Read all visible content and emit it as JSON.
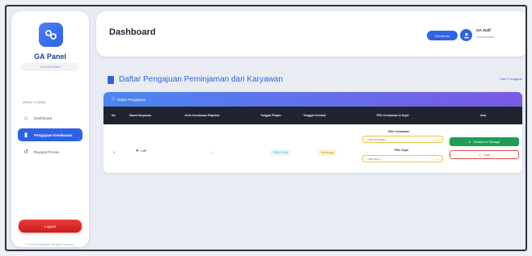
{
  "sidebar": {
    "brand": "GA Panel",
    "brand_sub": "General Affairs",
    "nav_heading": "MENU UTAMA",
    "items": [
      {
        "label": "Dashboard",
        "icon": "home-icon"
      },
      {
        "label": "Pengajuan Kendaraan",
        "icon": "document-icon"
      },
      {
        "label": "Riwayat Proses",
        "icon": "history-icon"
      }
    ],
    "logout_label": "Logout",
    "copyright": "© 2024 GA System. All rights reserved."
  },
  "header": {
    "title": "Dashboard",
    "role_badge": "GA Admin",
    "user_name": "GA Staff",
    "user_role": "General Affairs"
  },
  "section": {
    "title": "Daftar Pengajuan Peminjaman dari Karyawan",
    "link": "Total 1 Pengajuan"
  },
  "table": {
    "card_title": "Daftar Pengajuan",
    "columns": [
      "No",
      "Nama Karyawan",
      "Jenis Kendaraan Diajukan",
      "Tanggal Pinjam",
      "Tanggal Kembali",
      "Pilih Kendaraan & Sopir",
      "Aksi"
    ],
    "rows": [
      {
        "no": "1",
        "name": "luffi",
        "vehicle": "—",
        "date_borrow": "2024-12-06",
        "date_return": "Menunggu",
        "label_vehicle": "Pilih Kendaraan",
        "select_vehicle": "-- Pilih Kendaraan --",
        "label_driver": "Pilih Sopir",
        "select_driver": "-- Pilih Sopir --",
        "approve": "Teruskan ke Manager",
        "reject": "Tolak"
      }
    ]
  },
  "colors": {
    "accent": "#2f63e6",
    "danger": "#e04b4b",
    "success": "#1f9d55"
  }
}
